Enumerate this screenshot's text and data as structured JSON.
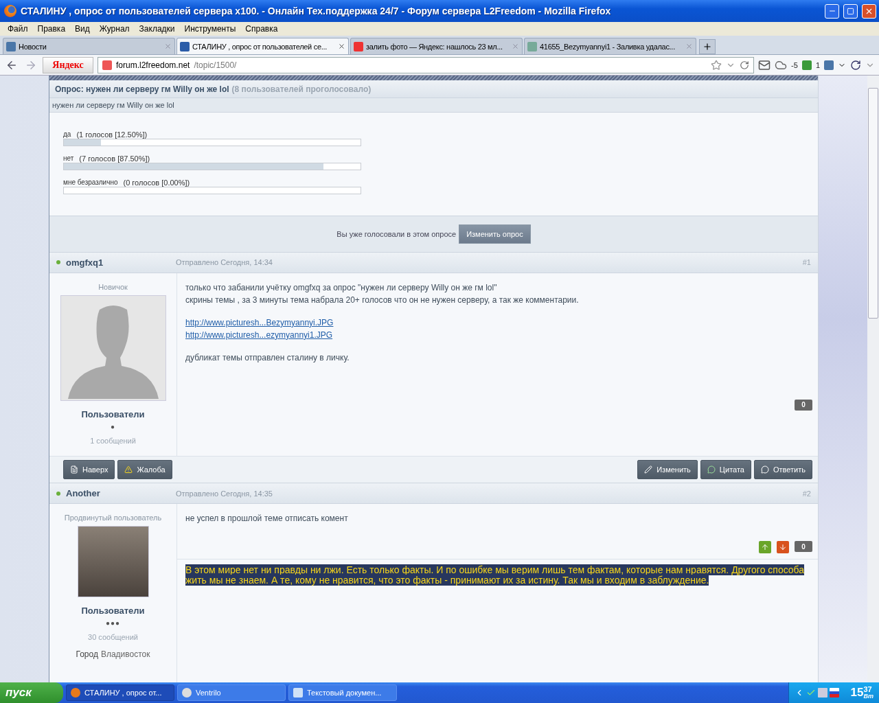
{
  "window": {
    "title": "СТАЛИНУ , опрос от пользователей сервера x100. - Онлайн Тех.поддержка 24/7 - Форум сервера L2Freedom - Mozilla Firefox"
  },
  "menu": [
    "Файл",
    "Правка",
    "Вид",
    "Журнал",
    "Закладки",
    "Инструменты",
    "Справка"
  ],
  "tabs": [
    {
      "label": "Новости",
      "selected": false,
      "kind": "vk"
    },
    {
      "label": "СТАЛИНУ , опрос от пользователей се...",
      "selected": true,
      "kind": "l2f"
    },
    {
      "label": "залить фото — Яндекс: нашлось 23 мл...",
      "selected": false,
      "kind": "yandex"
    },
    {
      "label": "41655_Bezymyannyi1 - Заливка удалас...",
      "selected": false,
      "kind": "image"
    }
  ],
  "navbar": {
    "search_logo": "Яндекс",
    "domain": "forum.l2freedom.net",
    "path": "/topic/1500/",
    "weather": "-5",
    "counter": "1"
  },
  "poll": {
    "title": "Опрос: нужен ли серверу гм Willy он же lol",
    "voters": "(8 пользователей проголосовало)",
    "question": "нужен ли серверу гм Willy он же lol",
    "options": [
      {
        "label": "да",
        "votes": "(1 голосов [12.50%])",
        "level": 0.125
      },
      {
        "label": "нет",
        "votes": "(7 голосов [87.50%])",
        "level": 0.875
      },
      {
        "label": "мне безразлично",
        "votes": "(0 голосов [0.00%])",
        "level": 0
      }
    ],
    "voted_note": "Вы уже голосовали в этом опросе",
    "change_button": "Изменить опрос"
  },
  "posts": [
    {
      "author": "omgfxq1",
      "online": true,
      "date": "Отправлено Сегодня, 14:34",
      "number": "#1",
      "rank": "Новичок",
      "avatar_photo": false,
      "group": "Пользователи",
      "pips": "●",
      "post_count": "1 сообщений",
      "paragraphs": [
        {
          "kind": "text",
          "lines": [
            "только что забанили учётку omgfxq за опрос \"нужен ли серверу Willy он же гм lol\"",
            "скрины темы , за 3 минуты тема набрала 20+ голосов что он не нужен серверу, а так же комментарии."
          ]
        },
        {
          "kind": "link",
          "lines": [
            "http://www.picturesh...Bezymyannyi.JPG",
            "http://www.picturesh...ezymyannyi1.JPG"
          ]
        },
        {
          "kind": "text",
          "lines": [
            "дубликат темы отправлен сталину в личку."
          ]
        }
      ],
      "reputation": "0",
      "left_actions": [
        "Наверх",
        "Жалоба"
      ],
      "right_actions": [
        "Изменить",
        "Цитата",
        "Ответить"
      ]
    },
    {
      "author": "Another",
      "online": true,
      "date": "Отправлено Сегодня, 14:35",
      "number": "#2",
      "rank": "Продвинутый пользователь",
      "avatar_photo": true,
      "group": "Пользователи",
      "pips": "●●●",
      "post_count": "30 сообщений",
      "fields": [
        {
          "label": "Город",
          "value": "Владивосток"
        }
      ],
      "paragraphs": [
        {
          "kind": "text",
          "lines": [
            "не успел в прошлой теме отписать комент"
          ]
        }
      ],
      "rep_votes": true,
      "reputation": "0",
      "signature": "В этом мире нет ни правды ни лжи. Есть только факты. И по ошибке мы верим лишь тем фактам, которые нам нравятся. Другого способа жить мы не знаем. А те, кому не нравится, что это факты - принимают их за истину. Так мы и входим в заблуждение."
    }
  ],
  "taskbar": {
    "start": "пуск",
    "items": [
      {
        "label": "СТАЛИНУ , опрос от...",
        "selected": true,
        "kind": "firefox"
      },
      {
        "label": "Ventrilo",
        "selected": false,
        "kind": "ventrilo"
      },
      {
        "label": "Текстовый докумен...",
        "selected": false,
        "kind": "document"
      }
    ],
    "clock_hour": "15",
    "clock_minute": "37",
    "clock_day": "Вт"
  }
}
